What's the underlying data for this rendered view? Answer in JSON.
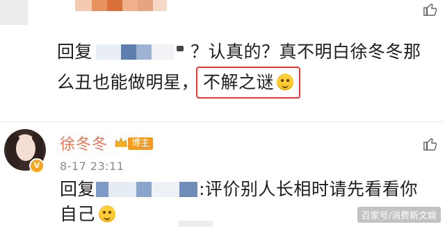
{
  "comments": [
    {
      "text_line1": "回复",
      "text_line1_suffix": "？认真的？真不明白徐冬冬那",
      "text_line2_prefix": "么丑也能做明星，",
      "highlighted_text": "不解之谜"
    },
    {
      "username": "徐冬冬",
      "badge_label": "博主",
      "timestamp": "8-17 23:11",
      "text_line1_prefix": "回复",
      "text_line1_suffix": ":评价别人长相时请先看看你",
      "text_line2": "自己"
    }
  ],
  "watermark": "百家号/消费新文娱",
  "icons": {
    "like": "thumbs-up-icon",
    "emoji_laugh": "laughing-emoji-icon",
    "emoji_shush": "shushing-emoji-icon",
    "verified": "verified-badge-icon",
    "crown": "crown-icon"
  },
  "colors": {
    "username": "#eb7350",
    "highlight_border": "#e33333",
    "badge": "#f39a1f"
  }
}
